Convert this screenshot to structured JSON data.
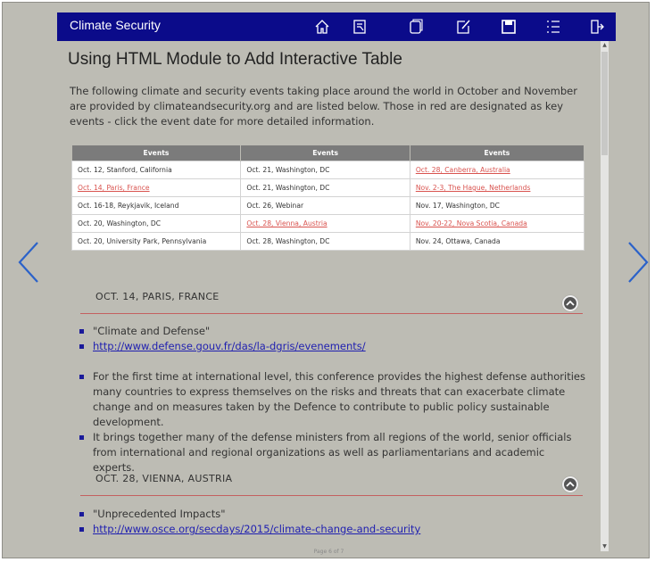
{
  "app": {
    "title": "Climate Security"
  },
  "toolbar": {
    "icons": [
      "home-icon",
      "bookmark-page-icon",
      "pages-icon",
      "notes-edit-icon",
      "save-icon",
      "list-icon",
      "exit-icon"
    ]
  },
  "page": {
    "title": "Using HTML Module to Add Interactive Table",
    "intro": "The following climate and security events taking place around the world in October and November are provided by climateandsecurity.org and are listed below. Those in red are designated as key events - click the event date for more detailed information.",
    "footer": "Page 6 of 7"
  },
  "table": {
    "headers": [
      "Events",
      "Events",
      "Events"
    ],
    "rows": [
      [
        {
          "text": "Oct. 12, Stanford, California",
          "key": false
        },
        {
          "text": "Oct. 21, Washington, DC",
          "key": false
        },
        {
          "text": "Oct. 28, Canberra, Australia",
          "key": true
        }
      ],
      [
        {
          "text": "Oct. 14, Paris, France",
          "key": true
        },
        {
          "text": "Oct. 21, Washington, DC",
          "key": false
        },
        {
          "text": "Nov. 2-3, The Hague, Netherlands",
          "key": true
        }
      ],
      [
        {
          "text": "Oct. 16-18, Reykjavik, Iceland",
          "key": false
        },
        {
          "text": "Oct. 26, Webinar",
          "key": false
        },
        {
          "text": "Nov. 17, Washington, DC",
          "key": false
        }
      ],
      [
        {
          "text": "Oct. 20, Washington, DC",
          "key": false
        },
        {
          "text": "Oct. 28, Vienna, Austria",
          "key": true
        },
        {
          "text": "Nov. 20-22, Nova Scotia, Canada",
          "key": true
        }
      ],
      [
        {
          "text": "Oct. 20, University Park, Pennsylvania",
          "key": false
        },
        {
          "text": "Oct. 28, Washington, DC",
          "key": false
        },
        {
          "text": "Nov. 24, Ottawa, Canada",
          "key": false
        }
      ]
    ]
  },
  "sections": [
    {
      "heading": "OCT. 14, PARIS, FRANCE",
      "event_name": "\"Climate and Defense\"",
      "link": "http://www.defense.gouv.fr/das/la-dgris/evenements/",
      "para1": "For the first time at international level, this conference provides the highest defense authorities many countries to express themselves on the risks and threats that can exacerbate climate change and on measures taken by the Defence to contribute to public policy sustainable development.",
      "para2": "It brings together many of the defense ministers from all regions of the world, senior officials from international and regional organizations as well as parliamentarians and academic experts."
    },
    {
      "heading": "OCT. 28, VIENNA, AUSTRIA",
      "event_name": "\"Unprecedented Impacts\"",
      "link": "http://www.osce.org/secdays/2015/climate-change-and-security"
    }
  ],
  "colors": {
    "topbar": "#0b0b8a",
    "background": "#bdbcb4",
    "key_event": "#d9534f",
    "link": "#1f1fb0",
    "nav_arrow": "#2b62c9"
  }
}
